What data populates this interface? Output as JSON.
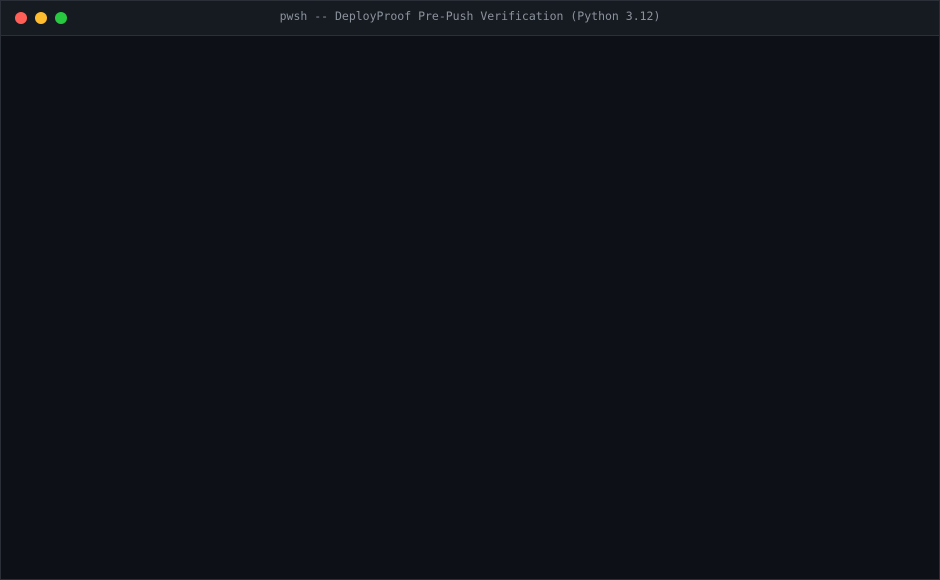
{
  "window": {
    "title": "pwsh -- DeployProof Pre-Push Verification (Python 3.12)",
    "controls": {
      "close_color": "#ff5f57",
      "minimize_color": "#febc2e",
      "zoom_color": "#28c840"
    }
  },
  "terminal": {
    "background_color": "#0d1017",
    "lines": []
  }
}
